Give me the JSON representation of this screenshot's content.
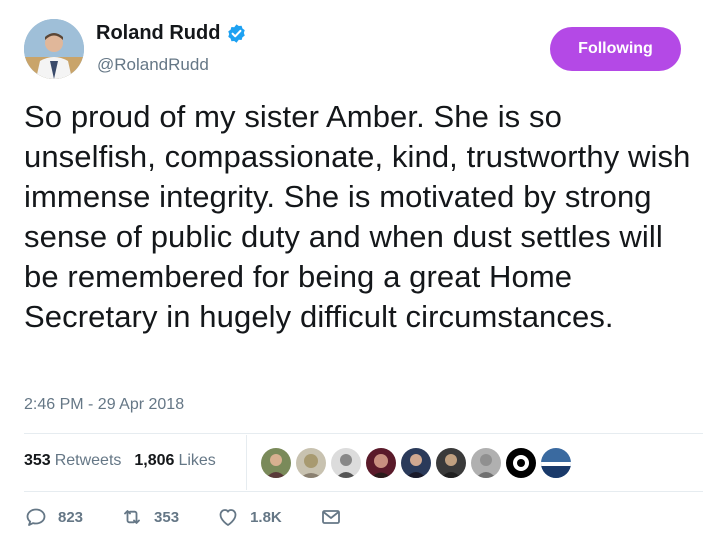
{
  "author": {
    "name": "Roland Rudd",
    "handle": "@RolandRudd",
    "verified": true
  },
  "follow_button": {
    "label": "Following",
    "color": "#b449e6"
  },
  "tweet": {
    "text": "So proud of my sister Amber. She is so unselfish, compassionate, kind, trustworthy wish immense integrity. She is motivated by strong sense of public duty and when dust settles will be remembered for being a great Home Secretary in hugely difficult circumstances.",
    "timestamp": "2:46 PM - 29 Apr 2018"
  },
  "stats": {
    "retweets_count": "353",
    "retweets_label": "Retweets",
    "likes_count": "1,806",
    "likes_label": "Likes"
  },
  "likers": [
    "avatar-1",
    "avatar-2",
    "avatar-3",
    "avatar-4",
    "avatar-5",
    "avatar-6",
    "avatar-7",
    "avatar-8",
    "avatar-9"
  ],
  "actions": {
    "reply_count": "823",
    "retweet_count": "353",
    "like_count": "1.8K"
  },
  "colors": {
    "text_primary": "#14171a",
    "text_secondary": "#657786",
    "verified_blue": "#1da1f2",
    "divider": "#e6ecf0"
  }
}
